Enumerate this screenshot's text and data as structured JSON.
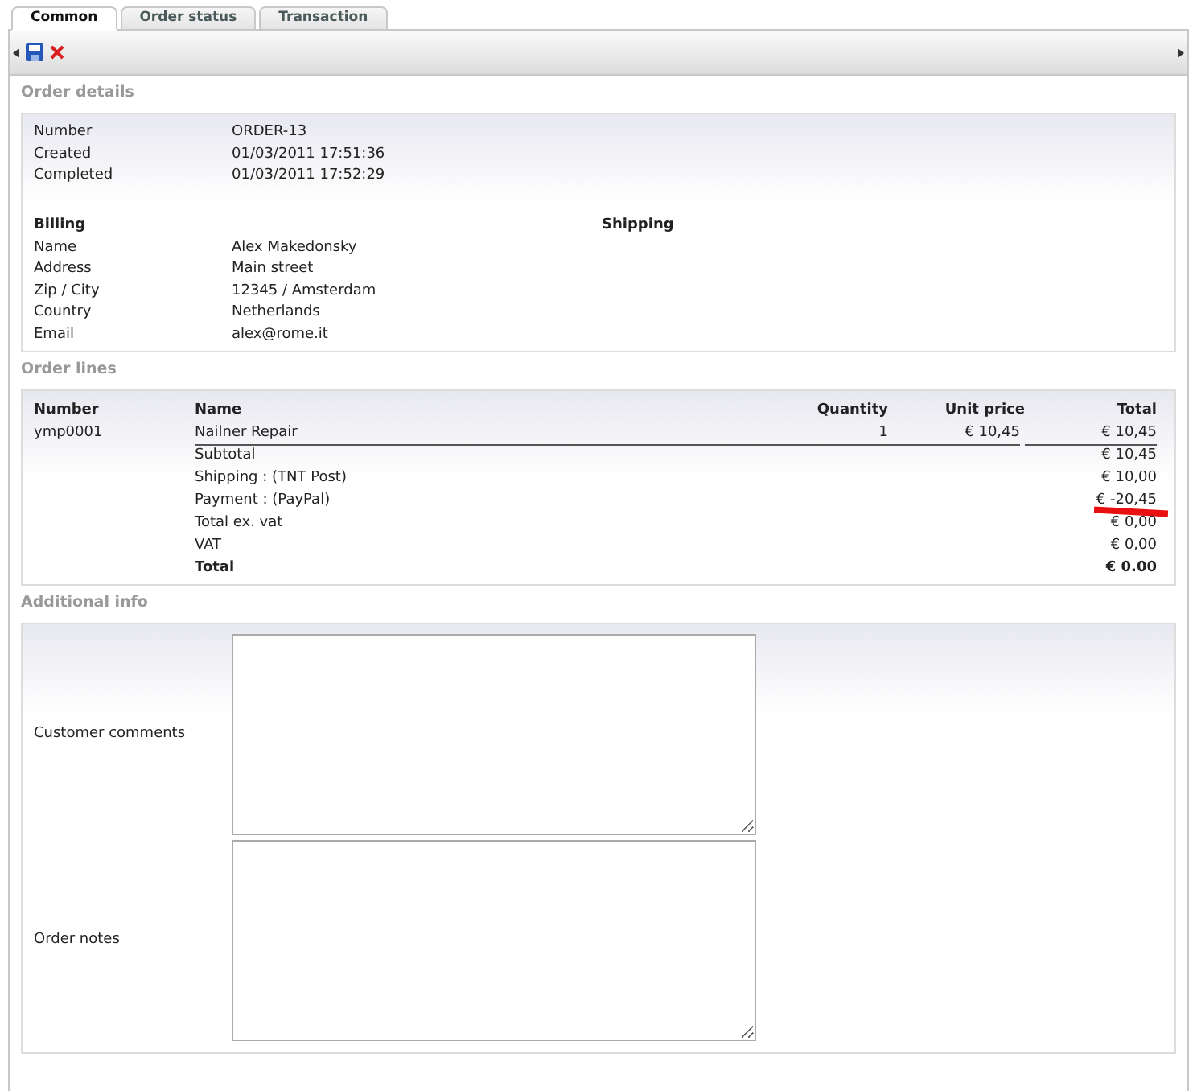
{
  "tabs": [
    {
      "label": "Common",
      "selected": true
    },
    {
      "label": "Order status",
      "selected": false
    },
    {
      "label": "Transaction",
      "selected": false
    }
  ],
  "order_details": {
    "title": "Order details",
    "fields": [
      {
        "label": "Number",
        "value": "ORDER-13"
      },
      {
        "label": "Created",
        "value": "01/03/2011 17:51:36"
      },
      {
        "label": "Completed",
        "value": "01/03/2011 17:52:29"
      }
    ],
    "billing_heading": "Billing",
    "shipping_heading": "Shipping",
    "billing": [
      {
        "label": "Name",
        "value": "Alex Makedonsky"
      },
      {
        "label": "Address",
        "value": "Main street"
      },
      {
        "label": "Zip / City",
        "value": "12345 / Amsterdam"
      },
      {
        "label": "Country",
        "value": "Netherlands"
      },
      {
        "label": "Email",
        "value": "alex@rome.it"
      }
    ]
  },
  "order_lines": {
    "title": "Order lines",
    "columns": [
      "Number",
      "Name",
      "Quantity",
      "Unit price",
      "Total"
    ],
    "rows": [
      {
        "number": "ymp0001",
        "name": "Nailner Repair",
        "quantity": "1",
        "unit_price": "€ 10,45",
        "total": "€ 10,45"
      }
    ],
    "summary": [
      {
        "label": "Subtotal",
        "value": "€ 10,45",
        "bold": false,
        "marked": false
      },
      {
        "label": "Shipping : (TNT Post)",
        "value": "€ 10,00",
        "bold": false,
        "marked": false
      },
      {
        "label": "Payment : (PayPal)",
        "value": "€ -20,45",
        "bold": false,
        "marked": true
      },
      {
        "label": "Total ex. vat",
        "value": "€ 0,00",
        "bold": false,
        "marked": false
      },
      {
        "label": "VAT",
        "value": "€ 0,00",
        "bold": false,
        "marked": false
      },
      {
        "label": "Total",
        "value": "€ 0.00",
        "bold": true,
        "marked": false
      }
    ]
  },
  "additional_info": {
    "title": "Additional info",
    "fields": [
      {
        "label": "Customer comments"
      },
      {
        "label": "Order notes"
      }
    ]
  }
}
